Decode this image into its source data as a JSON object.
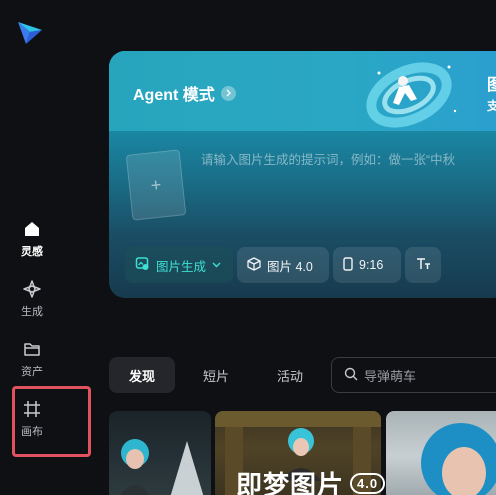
{
  "sidebar": {
    "items": [
      {
        "label": "灵感",
        "icon": "home-icon",
        "active": true
      },
      {
        "label": "生成",
        "icon": "sparkle-diamond-icon",
        "active": false
      },
      {
        "label": "资产",
        "icon": "folder-icon",
        "active": false
      },
      {
        "label": "画布",
        "icon": "crop-canvas-icon",
        "active": false
      }
    ]
  },
  "agent_card": {
    "title": "Agent 模式",
    "right_title": "图",
    "right_subtitle": "支",
    "prompt_placeholder": "请输入图片生成的提示词，例如：做一张“中秋",
    "upload_plus": "+",
    "toolbar": {
      "generate_mode": "图片生成",
      "model": "图片 4.0",
      "ratio": "9:16"
    }
  },
  "tabs": [
    {
      "label": "发现",
      "active": true
    },
    {
      "label": "短片",
      "active": false
    },
    {
      "label": "活动",
      "active": false
    }
  ],
  "search": {
    "placeholder": "导弹萌车"
  },
  "gallery": {
    "banner_text": "即梦图片",
    "banner_version": "4.0"
  },
  "colors": {
    "accent": "#3de0d3",
    "highlight_box": "#e0525e",
    "background": "#0f1013"
  }
}
